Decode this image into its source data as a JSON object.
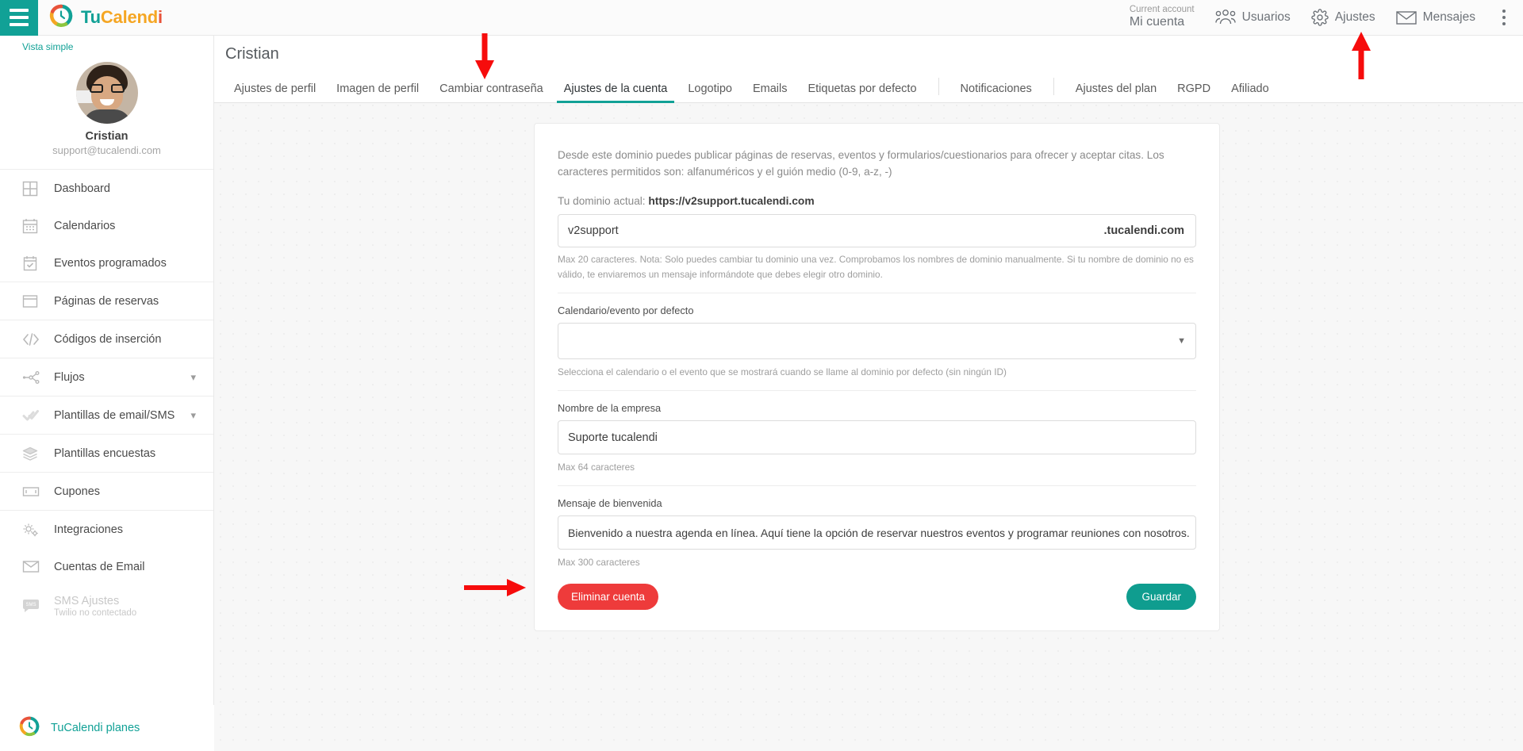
{
  "topbar": {
    "menu_icon": "hamburger-icon",
    "brand": {
      "part1": "Tu",
      "part2": "Calend",
      "part3": "i"
    },
    "account": {
      "label": "Current account",
      "value": "Mi cuenta"
    },
    "nav": [
      {
        "label": "Usuarios",
        "icon": "users-icon"
      },
      {
        "label": "Ajustes",
        "icon": "gear-icon"
      },
      {
        "label": "Mensajes",
        "icon": "envelope-icon"
      }
    ],
    "overflow_icon": "kebab-menu-icon"
  },
  "sidebar": {
    "view_mode": "Vista simple",
    "profile": {
      "name": "Cristian",
      "email": "support@tucalendi.com",
      "avatar": "user-avatar"
    },
    "items": [
      {
        "label": "Dashboard",
        "icon": "dashboard-grid-icon",
        "chevron": "",
        "sub": "",
        "dim": false
      },
      {
        "label": "Calendarios",
        "icon": "calendar-icon",
        "chevron": "",
        "sub": "",
        "dim": false
      },
      {
        "label": "Eventos programados",
        "icon": "calendar-check-icon",
        "chevron": "",
        "sub": "",
        "dim": false
      },
      {
        "label": "Páginas de reservas",
        "icon": "window-icon",
        "chevron": "",
        "sub": "",
        "dim": false
      },
      {
        "label": "Códigos de inserción",
        "icon": "code-icon",
        "chevron": "",
        "sub": "",
        "dim": false
      },
      {
        "label": "Flujos",
        "icon": "flow-nodes-icon",
        "chevron": "chevron-down-icon",
        "sub": "",
        "dim": false
      },
      {
        "label": "Plantillas de email/SMS",
        "icon": "double-check-icon",
        "chevron": "chevron-down-icon",
        "sub": "",
        "dim": false
      },
      {
        "label": "Plantillas encuestas",
        "icon": "layers-icon",
        "chevron": "",
        "sub": "",
        "dim": false
      },
      {
        "label": "Cupones",
        "icon": "ticket-icon",
        "chevron": "",
        "sub": "",
        "dim": false
      },
      {
        "label": "Integraciones",
        "icon": "gears-icon",
        "chevron": "",
        "sub": "",
        "dim": false
      },
      {
        "label": "Cuentas de Email",
        "icon": "envelope-icon",
        "chevron": "",
        "sub": "",
        "dim": false
      },
      {
        "label": "SMS Ajustes",
        "icon": "sms-bubble-icon",
        "chevron": "",
        "sub": "Twilio no contectado",
        "dim": true
      }
    ],
    "plans_link": "TuCalendi planes"
  },
  "page": {
    "title": "Cristian",
    "tabs": [
      {
        "label": "Ajustes de perfil",
        "active": false
      },
      {
        "label": "Imagen de perfil",
        "active": false
      },
      {
        "label": "Cambiar contraseña",
        "active": false
      },
      {
        "label": "Ajustes de la cuenta",
        "active": true
      },
      {
        "label": "Logotipo",
        "active": false
      },
      {
        "label": "Emails",
        "active": false
      },
      {
        "label": "Etiquetas por defecto",
        "active": false
      },
      {
        "label": "Notificaciones",
        "active": false
      },
      {
        "label": "Ajustes del plan",
        "active": false
      },
      {
        "label": "RGPD",
        "active": false
      },
      {
        "label": "Afiliado",
        "active": false
      }
    ]
  },
  "card": {
    "intro": "Desde este dominio puedes publicar páginas de reservas, eventos y formularios/cuestionarios para ofrecer y aceptar citas. Los caracteres permitidos son: alfanuméricos y el guión medio (0-9, a-z, -)",
    "domain_prefix": "Tu dominio actual:",
    "domain_current": "https://v2support.tucalendi.com",
    "domain_value": "v2support",
    "domain_suffix": ".tucalendi.com",
    "domain_hint": "Max 20 caracteres. Nota: Solo puedes cambiar tu dominio una vez. Comprobamos los nombres de dominio manualmente. Si tu nombre de dominio no es válido, te enviaremos un mensaje informándote que debes elegir otro dominio.",
    "default_cal_label": "Calendario/evento por defecto",
    "default_cal_value": "",
    "default_cal_hint": "Selecciona el calendario o el evento que se mostrará cuando se llame al dominio por defecto (sin ningún ID)",
    "company_label": "Nombre de la empresa",
    "company_value": "Suporte tucalendi",
    "company_hint": "Max 64 caracteres",
    "welcome_label": "Mensaje de bienvenida",
    "welcome_value": "Bienvenido a nuestra agenda en línea. Aquí tiene la opción de reservar nuestros eventos y programar reuniones con nosotros.",
    "welcome_hint": "Max 300 caracteres",
    "delete_button": "Eliminar cuenta",
    "save_button": "Guardar"
  },
  "annotations": {
    "color": "#f60c0c",
    "arrow_tab": "down-arrow-to-ajustes-de-la-cuenta-tab",
    "arrow_ajustes": "up-arrow-to-ajustes-nav",
    "arrow_delete": "right-arrow-to-eliminar-cuenta-button"
  },
  "colors": {
    "accent": "#11a196",
    "danger": "#ee3b3b",
    "brand_orange": "#f5a623",
    "brand_red": "#e8533a"
  }
}
